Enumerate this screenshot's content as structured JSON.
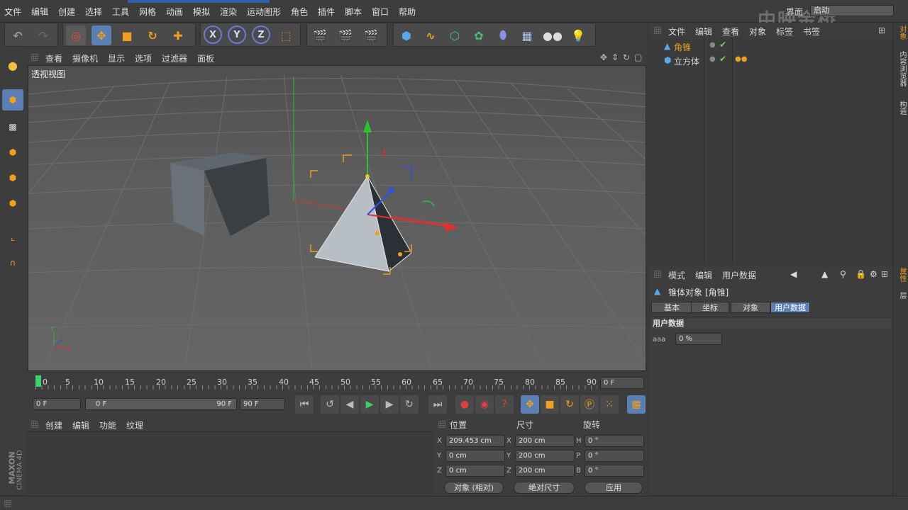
{
  "menu": [
    "文件",
    "编辑",
    "创建",
    "选择",
    "工具",
    "网格",
    "动画",
    "模拟",
    "渲染",
    "运动图形",
    "角色",
    "插件",
    "脚本",
    "窗口",
    "帮助"
  ],
  "layout": {
    "label": "界面",
    "value": "启动"
  },
  "watermark": "中映金桥",
  "viewport": {
    "menu": [
      "查看",
      "摄像机",
      "显示",
      "选项",
      "过滤器",
      "面板"
    ],
    "label": "透视视图"
  },
  "timeline": {
    "ticks": [
      "0",
      "5",
      "10",
      "15",
      "20",
      "25",
      "30",
      "35",
      "40",
      "45",
      "50",
      "55",
      "60",
      "65",
      "70",
      "75",
      "80",
      "85",
      "90"
    ],
    "current_frame": "0 F",
    "start_field": "0 F",
    "range_start": "0 F",
    "range_end": "90 F",
    "end_field": "90 F"
  },
  "material": {
    "menu": [
      "创建",
      "编辑",
      "功能",
      "纹理"
    ]
  },
  "coords": {
    "headers": [
      "位置",
      "尺寸",
      "旋转"
    ],
    "rows": [
      {
        "axis1": "X",
        "pos": "209.453 cm",
        "axis2": "X",
        "size": "200 cm",
        "axis3": "H",
        "rot": "0 °"
      },
      {
        "axis1": "Y",
        "pos": "0 cm",
        "axis2": "Y",
        "size": "200 cm",
        "axis3": "P",
        "rot": "0 °"
      },
      {
        "axis1": "Z",
        "pos": "0 cm",
        "axis2": "Z",
        "size": "200 cm",
        "axis3": "B",
        "rot": "0 °"
      }
    ],
    "mode": "对象 (相对)",
    "size_mode": "绝对尺寸",
    "apply": "应用"
  },
  "objects": {
    "menu": [
      "文件",
      "编辑",
      "查看",
      "对象",
      "标签",
      "书签"
    ],
    "items": [
      {
        "name": "角锥",
        "color": "#e8a020"
      },
      {
        "name": "立方体",
        "color": "#d2d2d2"
      }
    ]
  },
  "attributes": {
    "menu": [
      "模式",
      "编辑",
      "用户数据"
    ],
    "title": "锥体对象 [角锥]",
    "tabs": [
      "基本",
      "坐标",
      "对象",
      "用户数据"
    ],
    "active_tab": 3,
    "section": "用户数据",
    "field_label": "aaa",
    "field_value": "0 %"
  },
  "sidetabs": [
    "对象",
    "内容浏览器",
    "构造",
    "属性",
    "层"
  ],
  "brand": {
    "line1": "MAXON",
    "line2": "CINEMA 4D"
  },
  "colors": {
    "accent": "#5b7fb3",
    "x_axis": "#e03030",
    "y_axis": "#30c030",
    "z_axis": "#3050e0",
    "selection": "#e8a020"
  }
}
